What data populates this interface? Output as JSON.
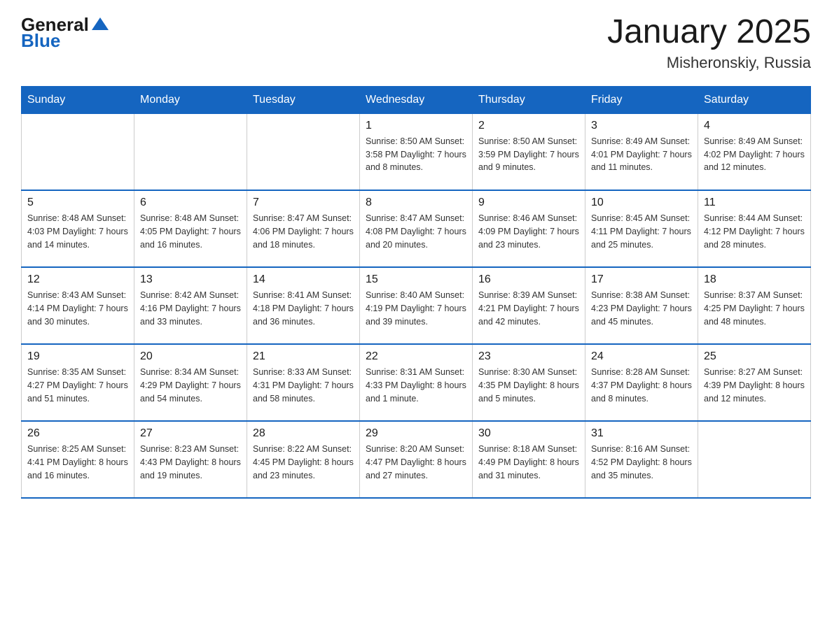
{
  "header": {
    "logo_general": "General",
    "logo_blue": "Blue",
    "title": "January 2025",
    "subtitle": "Misheronskiy, Russia"
  },
  "days_of_week": [
    "Sunday",
    "Monday",
    "Tuesday",
    "Wednesday",
    "Thursday",
    "Friday",
    "Saturday"
  ],
  "weeks": [
    [
      {
        "num": "",
        "info": ""
      },
      {
        "num": "",
        "info": ""
      },
      {
        "num": "",
        "info": ""
      },
      {
        "num": "1",
        "info": "Sunrise: 8:50 AM\nSunset: 3:58 PM\nDaylight: 7 hours and 8 minutes."
      },
      {
        "num": "2",
        "info": "Sunrise: 8:50 AM\nSunset: 3:59 PM\nDaylight: 7 hours and 9 minutes."
      },
      {
        "num": "3",
        "info": "Sunrise: 8:49 AM\nSunset: 4:01 PM\nDaylight: 7 hours and 11 minutes."
      },
      {
        "num": "4",
        "info": "Sunrise: 8:49 AM\nSunset: 4:02 PM\nDaylight: 7 hours and 12 minutes."
      }
    ],
    [
      {
        "num": "5",
        "info": "Sunrise: 8:48 AM\nSunset: 4:03 PM\nDaylight: 7 hours and 14 minutes."
      },
      {
        "num": "6",
        "info": "Sunrise: 8:48 AM\nSunset: 4:05 PM\nDaylight: 7 hours and 16 minutes."
      },
      {
        "num": "7",
        "info": "Sunrise: 8:47 AM\nSunset: 4:06 PM\nDaylight: 7 hours and 18 minutes."
      },
      {
        "num": "8",
        "info": "Sunrise: 8:47 AM\nSunset: 4:08 PM\nDaylight: 7 hours and 20 minutes."
      },
      {
        "num": "9",
        "info": "Sunrise: 8:46 AM\nSunset: 4:09 PM\nDaylight: 7 hours and 23 minutes."
      },
      {
        "num": "10",
        "info": "Sunrise: 8:45 AM\nSunset: 4:11 PM\nDaylight: 7 hours and 25 minutes."
      },
      {
        "num": "11",
        "info": "Sunrise: 8:44 AM\nSunset: 4:12 PM\nDaylight: 7 hours and 28 minutes."
      }
    ],
    [
      {
        "num": "12",
        "info": "Sunrise: 8:43 AM\nSunset: 4:14 PM\nDaylight: 7 hours and 30 minutes."
      },
      {
        "num": "13",
        "info": "Sunrise: 8:42 AM\nSunset: 4:16 PM\nDaylight: 7 hours and 33 minutes."
      },
      {
        "num": "14",
        "info": "Sunrise: 8:41 AM\nSunset: 4:18 PM\nDaylight: 7 hours and 36 minutes."
      },
      {
        "num": "15",
        "info": "Sunrise: 8:40 AM\nSunset: 4:19 PM\nDaylight: 7 hours and 39 minutes."
      },
      {
        "num": "16",
        "info": "Sunrise: 8:39 AM\nSunset: 4:21 PM\nDaylight: 7 hours and 42 minutes."
      },
      {
        "num": "17",
        "info": "Sunrise: 8:38 AM\nSunset: 4:23 PM\nDaylight: 7 hours and 45 minutes."
      },
      {
        "num": "18",
        "info": "Sunrise: 8:37 AM\nSunset: 4:25 PM\nDaylight: 7 hours and 48 minutes."
      }
    ],
    [
      {
        "num": "19",
        "info": "Sunrise: 8:35 AM\nSunset: 4:27 PM\nDaylight: 7 hours and 51 minutes."
      },
      {
        "num": "20",
        "info": "Sunrise: 8:34 AM\nSunset: 4:29 PM\nDaylight: 7 hours and 54 minutes."
      },
      {
        "num": "21",
        "info": "Sunrise: 8:33 AM\nSunset: 4:31 PM\nDaylight: 7 hours and 58 minutes."
      },
      {
        "num": "22",
        "info": "Sunrise: 8:31 AM\nSunset: 4:33 PM\nDaylight: 8 hours and 1 minute."
      },
      {
        "num": "23",
        "info": "Sunrise: 8:30 AM\nSunset: 4:35 PM\nDaylight: 8 hours and 5 minutes."
      },
      {
        "num": "24",
        "info": "Sunrise: 8:28 AM\nSunset: 4:37 PM\nDaylight: 8 hours and 8 minutes."
      },
      {
        "num": "25",
        "info": "Sunrise: 8:27 AM\nSunset: 4:39 PM\nDaylight: 8 hours and 12 minutes."
      }
    ],
    [
      {
        "num": "26",
        "info": "Sunrise: 8:25 AM\nSunset: 4:41 PM\nDaylight: 8 hours and 16 minutes."
      },
      {
        "num": "27",
        "info": "Sunrise: 8:23 AM\nSunset: 4:43 PM\nDaylight: 8 hours and 19 minutes."
      },
      {
        "num": "28",
        "info": "Sunrise: 8:22 AM\nSunset: 4:45 PM\nDaylight: 8 hours and 23 minutes."
      },
      {
        "num": "29",
        "info": "Sunrise: 8:20 AM\nSunset: 4:47 PM\nDaylight: 8 hours and 27 minutes."
      },
      {
        "num": "30",
        "info": "Sunrise: 8:18 AM\nSunset: 4:49 PM\nDaylight: 8 hours and 31 minutes."
      },
      {
        "num": "31",
        "info": "Sunrise: 8:16 AM\nSunset: 4:52 PM\nDaylight: 8 hours and 35 minutes."
      },
      {
        "num": "",
        "info": ""
      }
    ]
  ]
}
